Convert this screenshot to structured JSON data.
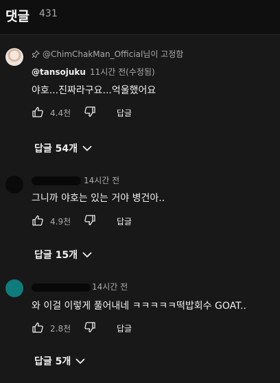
{
  "header": {
    "title": "댓글",
    "count": "431"
  },
  "comments": [
    {
      "pinned_text": "@ChimChakMan_Official님이 고정함",
      "author": "@tansojuku",
      "time": "11시간 전(수정됨)",
      "text": "야호...진짜라구요...억울했어요",
      "likes": "4.4천",
      "reply_label": "답글",
      "replies_label": "답글 54개"
    },
    {
      "author": "",
      "time": "14시간 전",
      "text": "그니까 야호는 있는 거야 병건아..",
      "likes": "4.9천",
      "reply_label": "답글",
      "replies_label": "답글 15개"
    },
    {
      "author": "",
      "time": "14시간 전",
      "text": "와 이걸 이렇게 풀어내네 ㅋㅋㅋㅋㅋ떡밥회수 GOAT..",
      "likes": "2.8천",
      "reply_label": "답글",
      "replies_label": "답글 5개"
    }
  ],
  "colors": {
    "avatar_teal": "#0e7c7b",
    "background": "#181818"
  }
}
